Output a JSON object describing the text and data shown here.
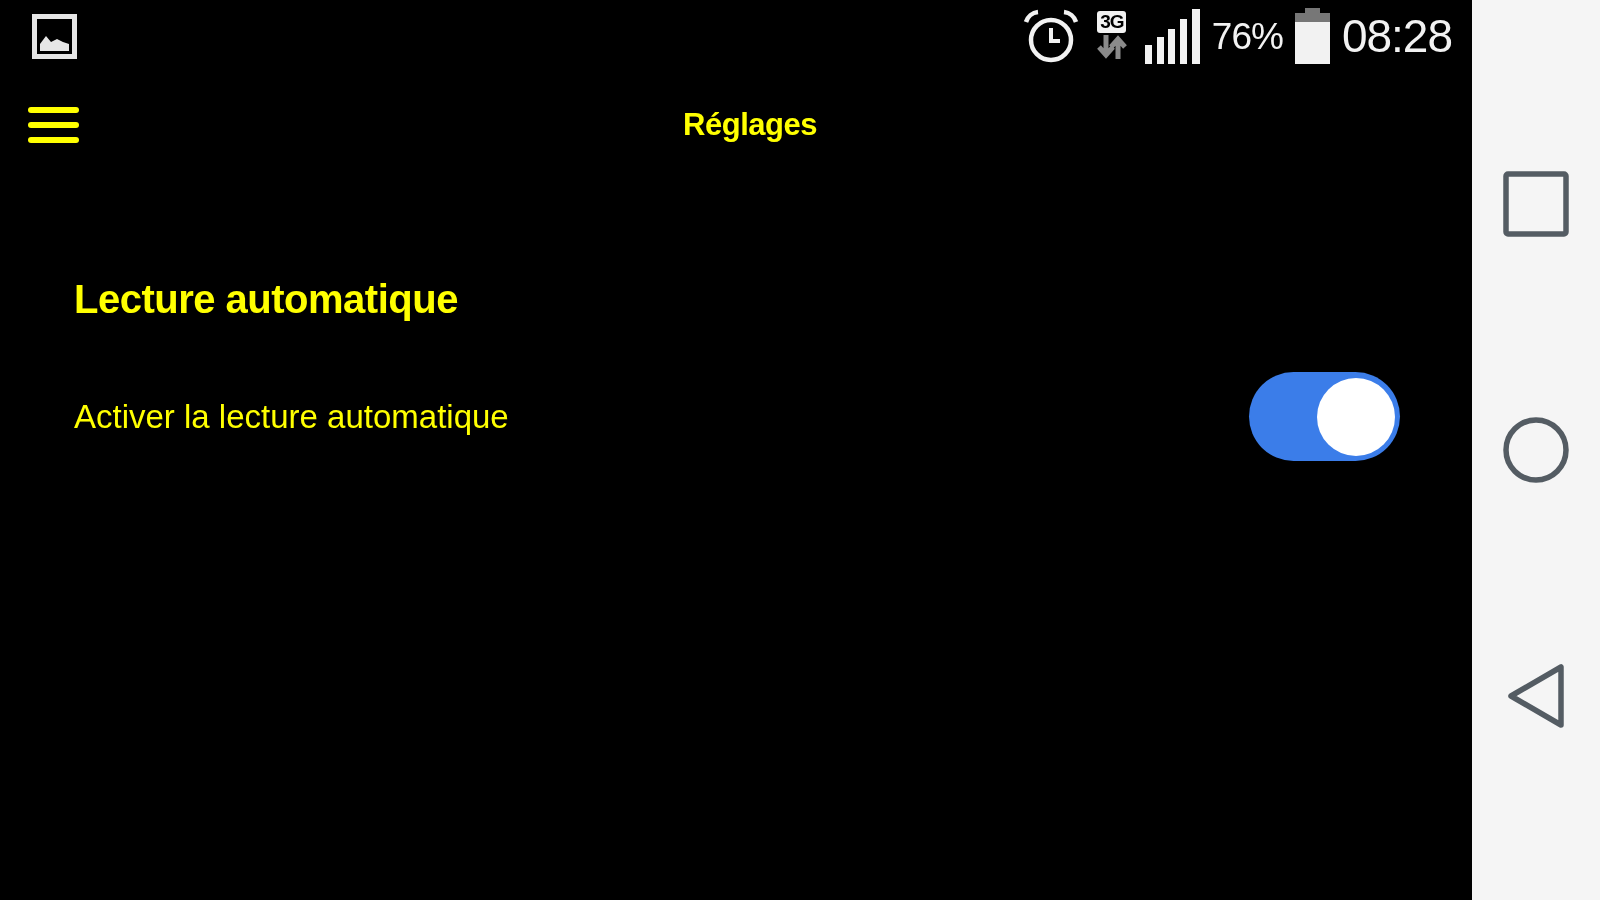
{
  "status_bar": {
    "network": "3G",
    "battery": "76%",
    "time": "08:28"
  },
  "app_bar": {
    "title": "Réglages"
  },
  "sections": [
    {
      "title": "Lecture automatique",
      "settings": [
        {
          "label": "Activer la lecture automatique",
          "on": true
        }
      ]
    }
  ]
}
